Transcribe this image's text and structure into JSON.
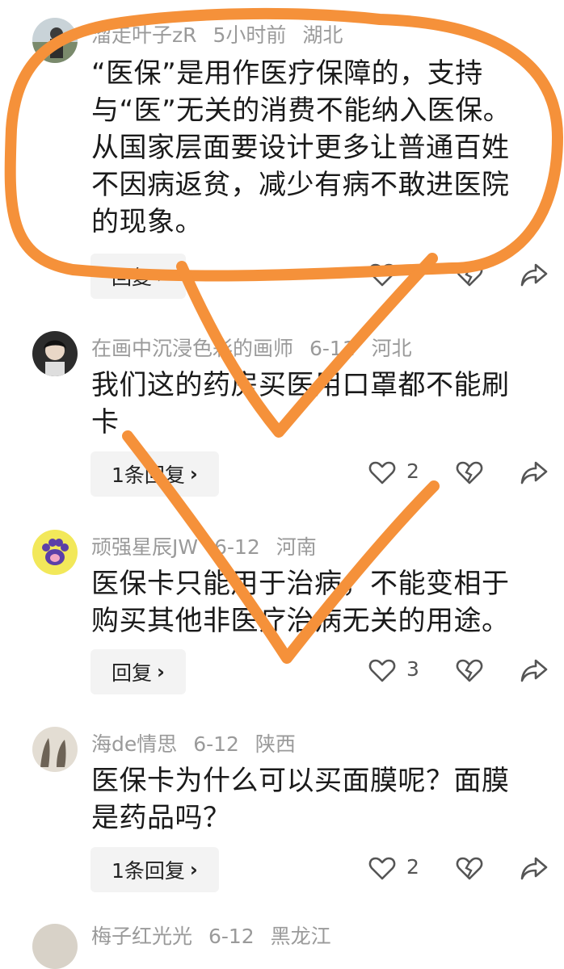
{
  "comments": [
    {
      "username": "溜走叶子zR",
      "time": "5小时前",
      "location": "湖北",
      "text": "“医保”是用作医疗保障的，支持与“医”无关的消费不能纳入医保。从国家层面要设计更多让普通百姓不因病返贫，减少有病不敢进医院的现象。",
      "reply_label": "回复",
      "like_count": ""
    },
    {
      "username": "在画中沉浸色彩的画师",
      "time": "6-11",
      "location": "河北",
      "text": "我们这的药房买医用口罩都不能刷卡",
      "reply_label": "1条回复",
      "like_count": "2"
    },
    {
      "username": "顽强星辰JW",
      "time": "6-12",
      "location": "河南",
      "text": "医保卡只能用于治病，不能变相于购买其他非医疗治病无关的用途。",
      "reply_label": "回复",
      "like_count": "3"
    },
    {
      "username": "海de情思",
      "time": "6-12",
      "location": "陕西",
      "text": "医保卡为什么可以买面膜呢？面膜是药品吗？",
      "reply_label": "1条回复",
      "like_count": "2"
    },
    {
      "username": "梅子红光光",
      "time": "6-12",
      "location": "黑龙江"
    }
  ],
  "icons": {
    "reply_chevron": "chevron-right-icon",
    "like": "heart-icon",
    "dislike": "broken-heart-icon",
    "share": "share-arrow-icon"
  },
  "colors": {
    "annotation": "#f5913a",
    "meta_text": "#9a9a9a",
    "reply_bg": "#f3f3f3"
  }
}
